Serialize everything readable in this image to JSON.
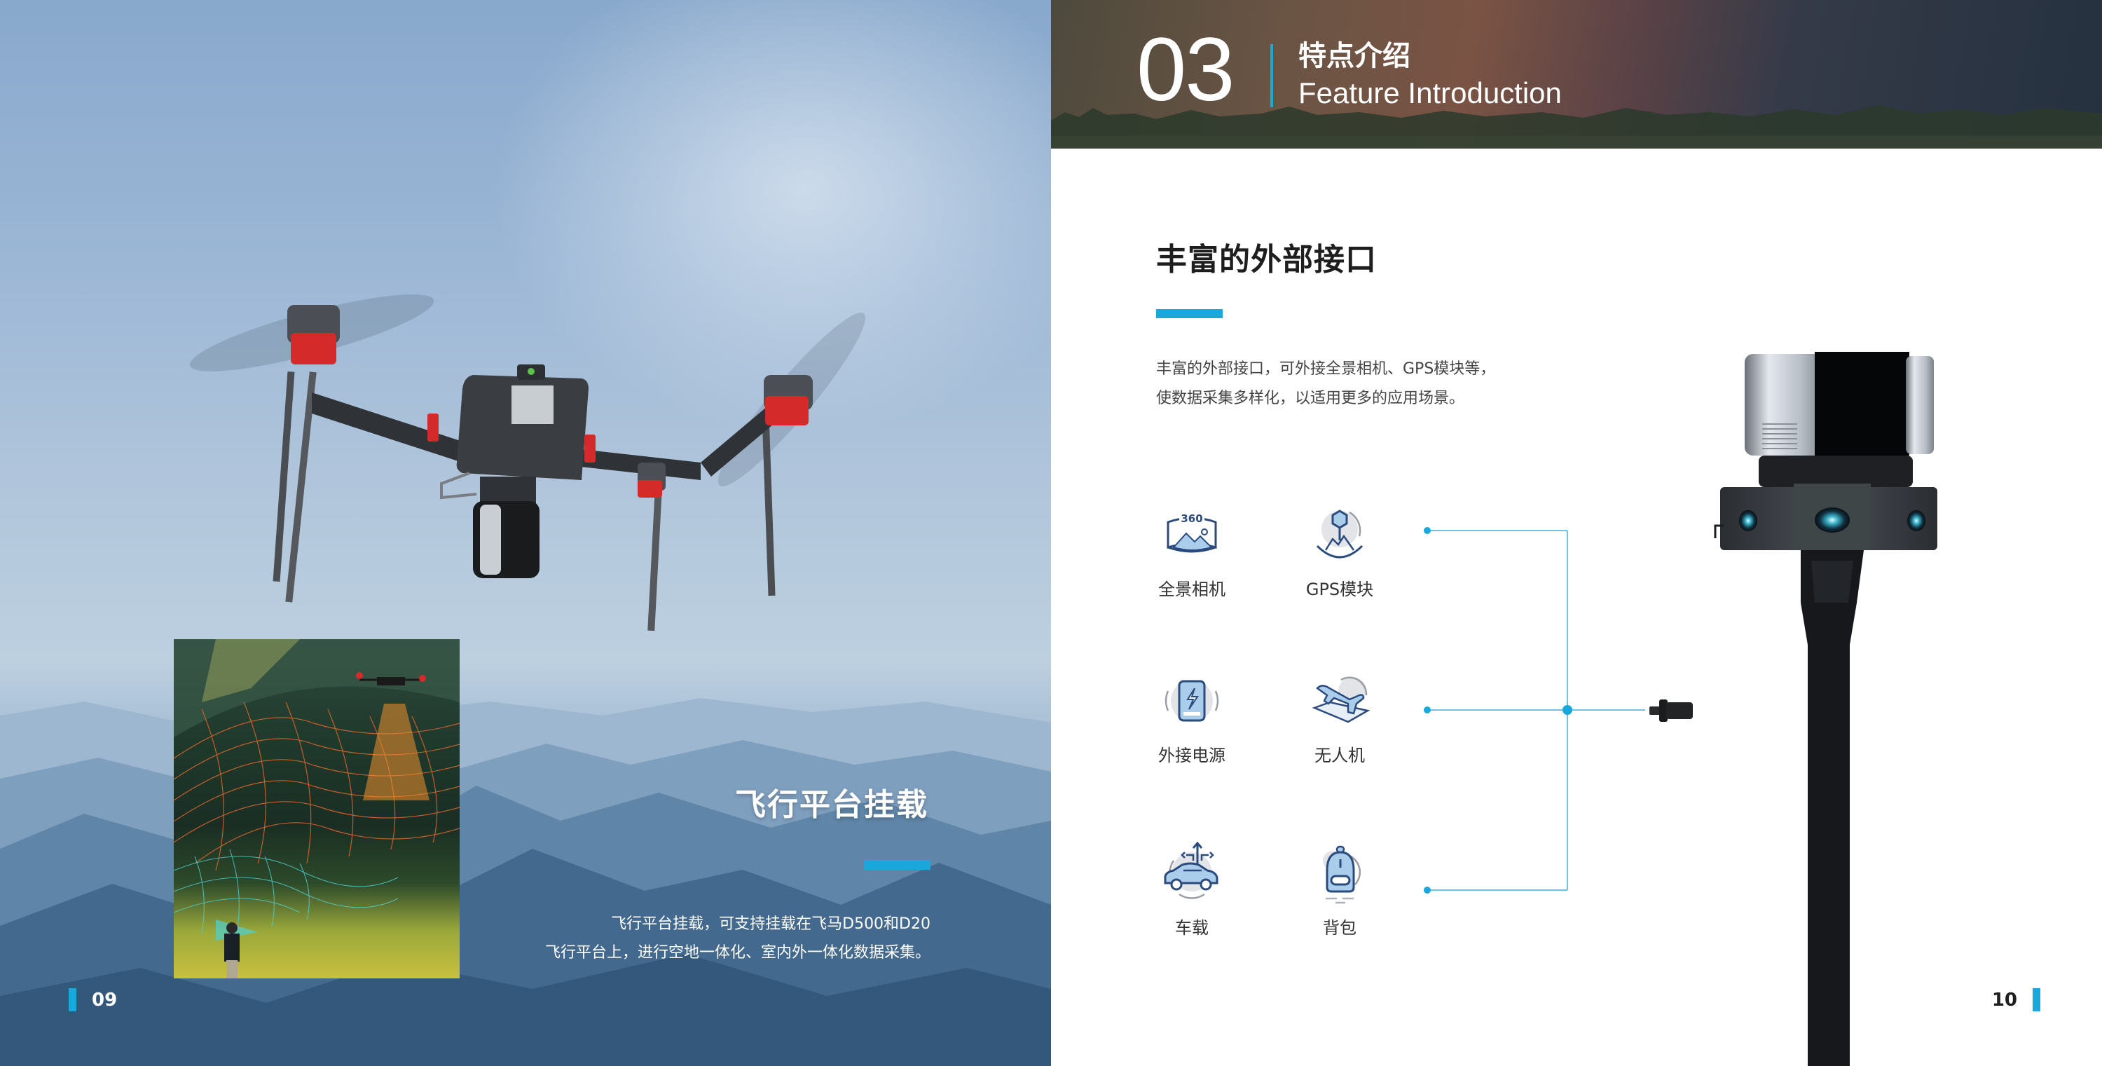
{
  "left_page": {
    "title": "飞行平台挂载",
    "body_lines": [
      "飞行平台挂载，可支持挂载在飞马D500和D20",
      "飞行平台上，进行空地一体化、室内外一体化数据采集。"
    ],
    "page_number": "09",
    "images": {
      "hero": "drone-with-lidar-scanner",
      "inset": "air-ground-scanning-mesh-illustration"
    }
  },
  "right_page": {
    "section": {
      "number": "03",
      "title_cn": "特点介绍",
      "title_en": "Feature Introduction"
    },
    "heading": "丰富的外部接口",
    "body_lines": [
      "丰富的外部接口，可外接全景相机、GPS模块等，",
      "使数据采集多样化，以适用更多的应用场景。"
    ],
    "features": [
      {
        "label": "全景相机",
        "icon": "panorama-360-camera-icon"
      },
      {
        "label": "GPS模块",
        "icon": "gps-pin-icon"
      },
      {
        "label": "外接电源",
        "icon": "power-bank-icon"
      },
      {
        "label": "无人机",
        "icon": "airplane-drone-icon"
      },
      {
        "label": "车载",
        "icon": "car-icon"
      },
      {
        "label": "背包",
        "icon": "backpack-icon"
      }
    ],
    "product_image": "handheld-lidar-scanner",
    "page_number": "10"
  },
  "colors": {
    "accent": "#1aa8dc",
    "icon_stroke": "#2b4b7e",
    "icon_fill": "#a9cdea",
    "icon_halo": "#e2e4e8",
    "heading_text": "#1e1e1e",
    "body_text": "#444444"
  }
}
